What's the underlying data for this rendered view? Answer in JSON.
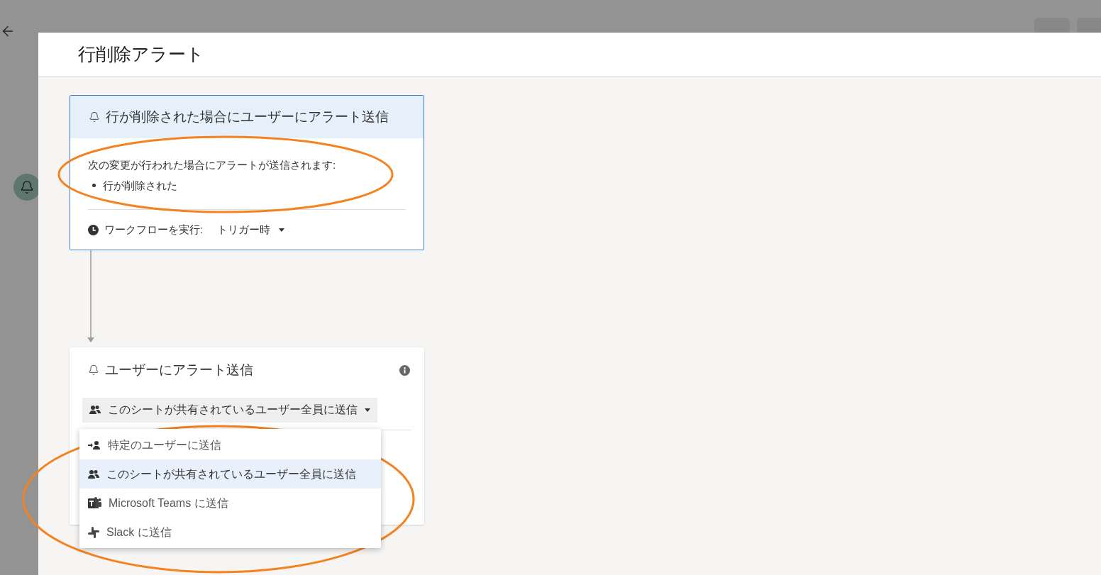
{
  "dialog": {
    "title": "行削除アラート"
  },
  "trigger_card": {
    "title": "行が削除された場合にユーザーにアラート送信",
    "description": "次の変更が行われた場合にアラートが送信されます:",
    "conditions": [
      "行が削除された"
    ],
    "run_label": "ワークフローを実行:",
    "run_value": "トリガー時"
  },
  "action_card": {
    "title": "ユーザーにアラート送信",
    "recipient": {
      "value": "このシートが共有されているユーザー全員に送信",
      "expanded": true,
      "options": [
        {
          "kind": "user",
          "label": "特定のユーザーに送信",
          "selected": false
        },
        {
          "kind": "group",
          "label": "このシートが共有されているユーザー全員に送信",
          "selected": true
        },
        {
          "kind": "teams",
          "label": "Microsoft Teams に送信",
          "selected": false
        },
        {
          "kind": "slack",
          "label": "Slack に送信",
          "selected": false
        }
      ]
    }
  }
}
